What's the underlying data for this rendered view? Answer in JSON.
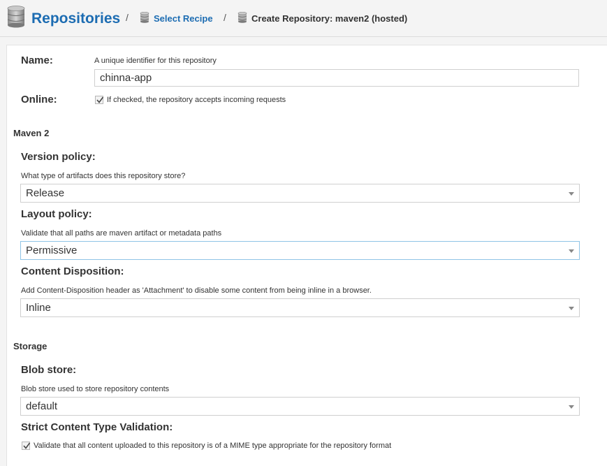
{
  "breadcrumb": {
    "root": "Repositories",
    "separator": "/",
    "select_recipe": "Select Recipe",
    "current": "Create Repository: maven2 (hosted)"
  },
  "form": {
    "name": {
      "label": "Name:",
      "help": "A unique identifier for this repository",
      "value": "chinna-app"
    },
    "online": {
      "label": "Online:",
      "checked": true,
      "help": "If checked, the repository accepts incoming requests"
    },
    "maven": {
      "section": "Maven 2",
      "version_policy": {
        "label": "Version policy:",
        "help": "What type of artifacts does this repository store?",
        "value": "Release"
      },
      "layout_policy": {
        "label": "Layout policy:",
        "help": "Validate that all paths are maven artifact or metadata paths",
        "value": "Permissive"
      },
      "content_disposition": {
        "label": "Content Disposition:",
        "help": "Add Content-Disposition header as 'Attachment' to disable some content from being inline in a browser.",
        "value": "Inline"
      }
    },
    "storage": {
      "section": "Storage",
      "blob_store": {
        "label": "Blob store:",
        "help": "Blob store used to store repository contents",
        "value": "default"
      },
      "strict_validation": {
        "label": "Strict Content Type Validation:",
        "checked": true,
        "help": "Validate that all content uploaded to this repository is of a MIME type appropriate for the repository format"
      }
    }
  },
  "colors": {
    "link": "#1c6cb2",
    "focus_border": "#8fc4e6"
  }
}
